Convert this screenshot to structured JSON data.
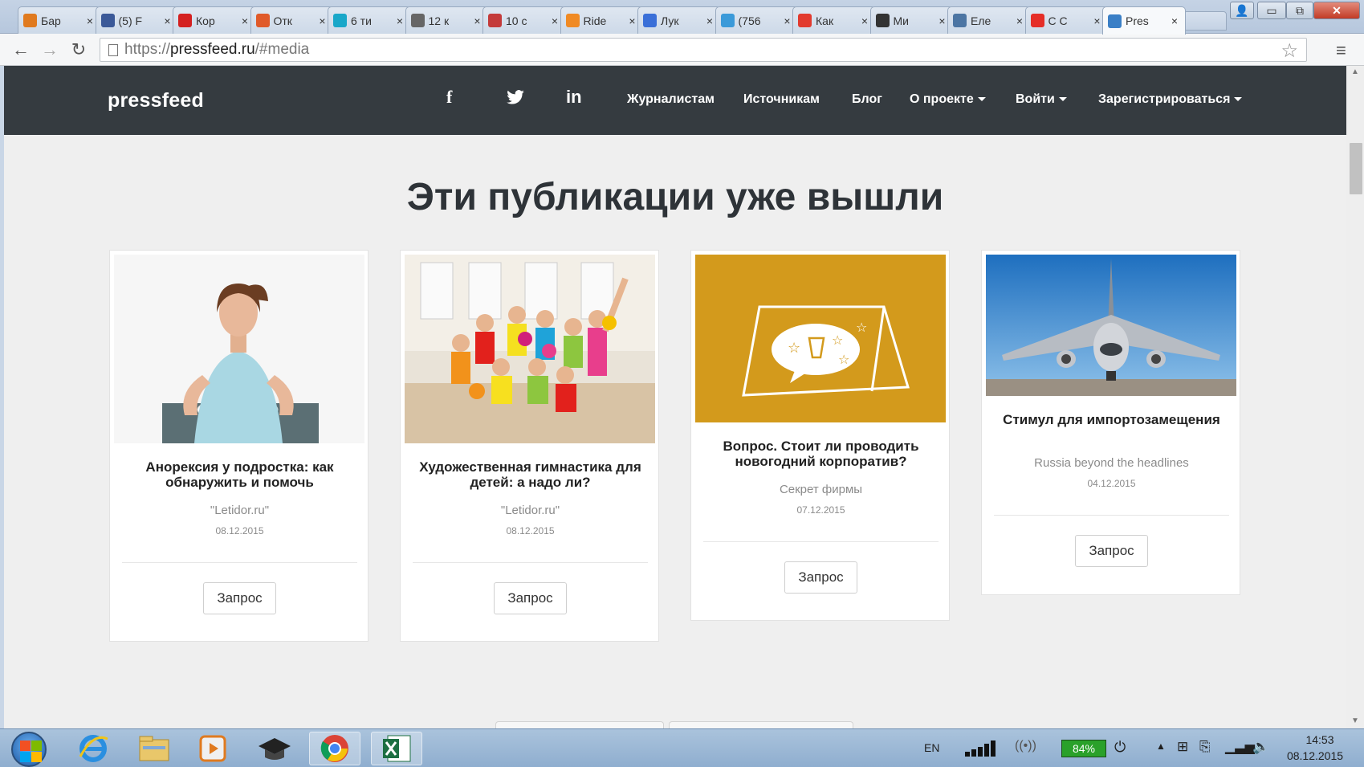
{
  "browser": {
    "tabs": [
      {
        "title": "Бар",
        "icon": "flame-icon",
        "color": "#e07a1f"
      },
      {
        "title": "(5) F",
        "icon": "facebook-icon",
        "color": "#3b5998"
      },
      {
        "title": "Кор",
        "icon": "l-icon",
        "color": "#d42020"
      },
      {
        "title": "Отк",
        "icon": "bubble-icon",
        "color": "#e05a2a"
      },
      {
        "title": "6 ти",
        "icon": "circle-icon",
        "color": "#19a7c9"
      },
      {
        "title": "12 к",
        "icon": "hand-icon",
        "color": "#666666"
      },
      {
        "title": "10 с",
        "icon": "r-icon",
        "color": "#c43a3a"
      },
      {
        "title": "Ride",
        "icon": "r-square-icon",
        "color": "#f08a24"
      },
      {
        "title": "Лук",
        "icon": "diamond-icon",
        "color": "#3a6fd8"
      },
      {
        "title": "(756",
        "icon": "at-icon",
        "color": "#3b9ad9"
      },
      {
        "title": "Как",
        "icon": "m-icon",
        "color": "#e23a2e"
      },
      {
        "title": "Ми",
        "icon": "compass-icon",
        "color": "#333333"
      },
      {
        "title": "Еле",
        "icon": "vk-icon",
        "color": "#4c75a3"
      },
      {
        "title": "C C",
        "icon": "youtube-icon",
        "color": "#e52d27"
      },
      {
        "title": "Pres",
        "icon": "pf-icon",
        "color": "#3a7fc6",
        "active": true
      }
    ],
    "url_prefix": "https://",
    "url_host": "pressfeed.ru",
    "url_path": "/#media"
  },
  "site": {
    "logo": "pressfeed",
    "social": {
      "facebook": "f",
      "twitter": "🐦",
      "linkedin": "in"
    },
    "nav": {
      "journalists": "Журналистам",
      "sources": "Источникам",
      "blog": "Блог",
      "about": "О проекте",
      "login": "Войти",
      "register": "Зарегистрироваться"
    },
    "section_title": "Эти публикации уже вышли",
    "cards": [
      {
        "title": "Анорексия у подростка: как обнаружить и помочь",
        "source": "\"Letidor.ru\"",
        "date": "08.12.2015",
        "button": "Запрос",
        "image": "girl-empty-plate"
      },
      {
        "title": "Художественная гимнастика для детей: а надо ли?",
        "source": "\"Letidor.ru\"",
        "date": "08.12.2015",
        "button": "Запрос",
        "image": "gymnastics-kids"
      },
      {
        "title": "Вопрос. Стоит ли проводить новогодний корпоратив?",
        "source": "Секрет фирмы",
        "date": "07.12.2015",
        "button": "Запрос",
        "image": "party-card-illustration"
      },
      {
        "title": "Стимул для импортозамещения",
        "source": "Russia beyond the headlines",
        "date": "04.12.2015",
        "button": "Запрос",
        "image": "airplane-front"
      }
    ]
  },
  "taskbar": {
    "lang": "EN",
    "battery": "84%",
    "time": "14:53",
    "date": "08.12.2015"
  }
}
